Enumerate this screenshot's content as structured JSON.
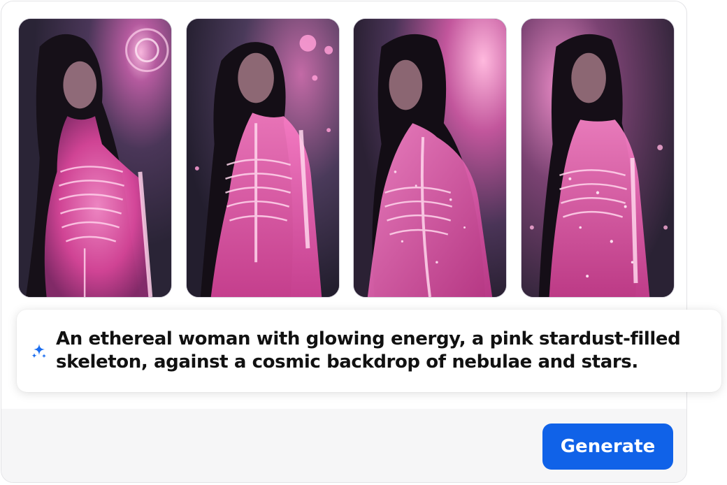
{
  "gallery": {
    "images": [
      {
        "name": "generated-image-1",
        "alt": "woman with glowing pink skeleton, spiral galaxy background"
      },
      {
        "name": "generated-image-2",
        "alt": "woman with glowing pink skeleton and stars"
      },
      {
        "name": "generated-image-3",
        "alt": "woman in profile with glowing pink skeleton, pink nebula"
      },
      {
        "name": "generated-image-4",
        "alt": "woman with glowing sparkling pink skeleton, nebula clouds"
      }
    ]
  },
  "prompt": {
    "text": "An ethereal woman with glowing energy,  a pink stardust-filled skeleton, against a cosmic backdrop of nebulae and stars.",
    "icon": "sparkle-icon"
  },
  "actions": {
    "generate_label": "Generate"
  },
  "colors": {
    "accent": "#1062e8",
    "sparkle": "#1a6df0",
    "glow": "#ff6fc4"
  }
}
